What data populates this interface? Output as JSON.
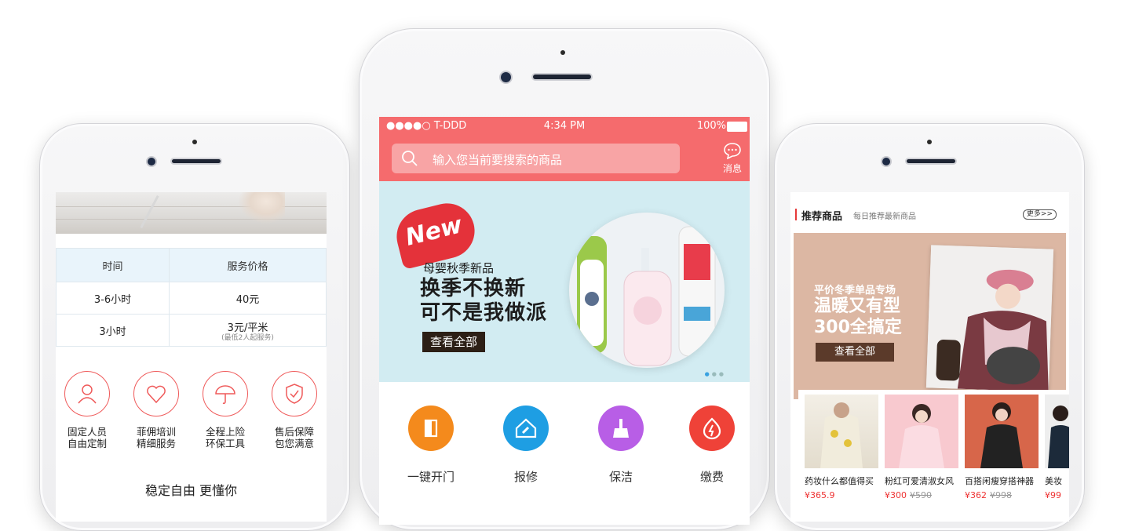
{
  "left_screen": {
    "table": {
      "headers": [
        "时间",
        "服务价格"
      ],
      "rows": [
        {
          "time": "3-6小时",
          "price": "40元",
          "note": ""
        },
        {
          "time": "3小时",
          "price": "3元/平米",
          "note": "(最低2人起服务)"
        }
      ]
    },
    "features": [
      {
        "icon": "person-icon",
        "line1": "固定人员",
        "line2": "自由定制"
      },
      {
        "icon": "heart-icon",
        "line1": "菲佣培训",
        "line2": "精细服务"
      },
      {
        "icon": "umbrella-icon",
        "line1": "全程上险",
        "line2": "环保工具"
      },
      {
        "icon": "shield-icon",
        "line1": "售后保障",
        "line2": "包您满意"
      }
    ],
    "slogan": "稳定自由 更懂你"
  },
  "middle_screen": {
    "status": {
      "carrier": "●●●●○ T-DDD",
      "time": "4:34 PM",
      "battery": "100%"
    },
    "search": {
      "placeholder": "输入您当前要搜索的商品"
    },
    "message_label": "消息",
    "banner": {
      "badge": "New",
      "subtitle": "母婴秋季新品",
      "title_line1": "换季不换新",
      "title_line2": "可不是我做派",
      "button": "查看全部"
    },
    "quick_actions": [
      {
        "icon": "door-icon",
        "label": "一键开门",
        "color": "#f48a1c"
      },
      {
        "icon": "repair-icon",
        "label": "报修",
        "color": "#1e9ee3"
      },
      {
        "icon": "broom-icon",
        "label": "保洁",
        "color": "#b85ee6"
      },
      {
        "icon": "fire-icon",
        "label": "缴费",
        "color": "#ef4238"
      }
    ],
    "accent_color": "#f56b6d"
  },
  "right_screen": {
    "section_title": "推荐商品",
    "section_subtitle": "每日推荐最新商品",
    "more_button": "更多>>",
    "promo": {
      "line1": "平价冬季单品专场",
      "line2": "温暖又有型",
      "line3": "300全搞定",
      "button": "查看全部"
    },
    "goods": [
      {
        "name": "药妆什么都值得买",
        "price": "¥365.9",
        "old_price": ""
      },
      {
        "name": "粉红可爱清淑女风",
        "price": "¥300",
        "old_price": "¥590"
      },
      {
        "name": "百搭闲瘦穿搭神器",
        "price": "¥362",
        "old_price": "¥998"
      },
      {
        "name": "美妆",
        "price": "¥99",
        "old_price": ""
      }
    ]
  }
}
